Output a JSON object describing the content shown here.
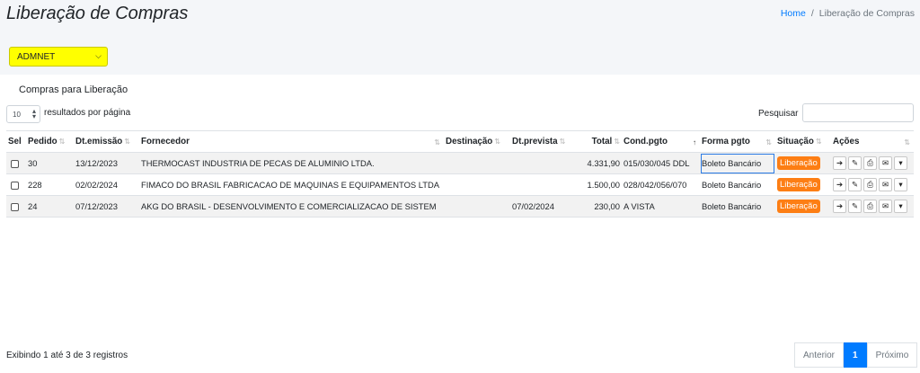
{
  "header": {
    "title": "Liberação de Compras",
    "breadcrumb": {
      "home": "Home",
      "separator": "/",
      "current": "Liberação de Compras"
    }
  },
  "company_select": {
    "value": "ADMNET"
  },
  "card": {
    "title": "Compras para Liberação",
    "length": {
      "value": "10",
      "label": "resultados por página"
    },
    "search": {
      "label": "Pesquisar",
      "value": ""
    }
  },
  "table": {
    "columns": {
      "sel": "Sel",
      "pedido": "Pedido",
      "emissao": "Dt.emissão",
      "fornecedor": "Fornecedor",
      "destinacao": "Destinação",
      "prevista": "Dt.prevista",
      "total": "Total",
      "cond": "Cond.pgto",
      "forma": "Forma pgto",
      "situacao": "Situação",
      "acoes": "Ações"
    },
    "rows": [
      {
        "pedido": "30",
        "emissao": "13/12/2023",
        "fornecedor": "THERMOCAST INDUSTRIA DE PECAS DE ALUMINIO LTDA.",
        "destinacao": "",
        "prevista": "",
        "total": "4.331,90",
        "cond": "015/030/045 DDL",
        "forma": "Boleto Bancário",
        "situacao": "Liberação"
      },
      {
        "pedido": "228",
        "emissao": "02/02/2024",
        "fornecedor": "FIMACO DO BRASIL FABRICACAO DE MAQUINAS E EQUIPAMENTOS LTDA",
        "destinacao": "",
        "prevista": "",
        "total": "1.500,00",
        "cond": "028/042/056/070",
        "forma": "Boleto Bancário",
        "situacao": "Liberação"
      },
      {
        "pedido": "24",
        "emissao": "07/12/2023",
        "fornecedor": "AKG DO BRASIL - DESENVOLVIMENTO E COMERCIALIZACAO DE SISTEM",
        "destinacao": "",
        "prevista": "07/02/2024",
        "total": "230,00",
        "cond": "A VISTA",
        "forma": "Boleto Bancário",
        "situacao": "Liberação"
      }
    ],
    "action_icons": [
      "arrow-right-icon",
      "edit-icon",
      "print-icon",
      "envelope-icon",
      "caret-down-icon"
    ]
  },
  "footer": {
    "info": "Exibindo 1 até 3 de 3 registros",
    "pagination": {
      "prev": "Anterior",
      "current": "1",
      "next": "Próximo"
    }
  },
  "colors": {
    "company_select_bg": "#ffff00",
    "badge": "#fd7e14",
    "primary": "#007bff"
  }
}
